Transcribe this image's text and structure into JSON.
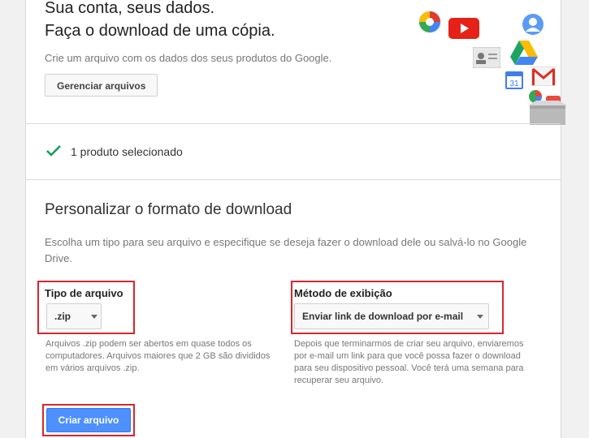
{
  "hero": {
    "title_line1": "Sua conta, seus dados.",
    "title_line2": "Faça o download de uma cópia.",
    "subtitle": "Crie um arquivo com os dados dos seus produtos do Google.",
    "manage_button": "Gerenciar arquivos",
    "calendar_day": "31"
  },
  "products": {
    "selected_text": "1 produto selecionado"
  },
  "format": {
    "heading": "Personalizar o formato de download",
    "description": "Escolha um tipo para seu arquivo e especifique se deseja fazer o download dele ou salvá-lo no Google Drive.",
    "file_type": {
      "label": "Tipo de arquivo",
      "value": ".zip",
      "help": "Arquivos .zip podem ser abertos em quase todos os computadores. Arquivos maiores que 2 GB são divididos em vários arquivos .zip."
    },
    "delivery": {
      "label": "Método de exibição",
      "value": "Enviar link de download por e-mail",
      "help": "Depois que terminarmos de criar seu arquivo, enviaremos por e-mail um link para que você possa fazer o download para seu dispositivo pessoal. Você terá uma semana para recuperar seu arquivo."
    },
    "create_button": "Criar arquivo"
  },
  "colors": {
    "accent_blue": "#4d90fe",
    "highlight_red": "#d8262e",
    "check_green": "#0f9d58"
  }
}
